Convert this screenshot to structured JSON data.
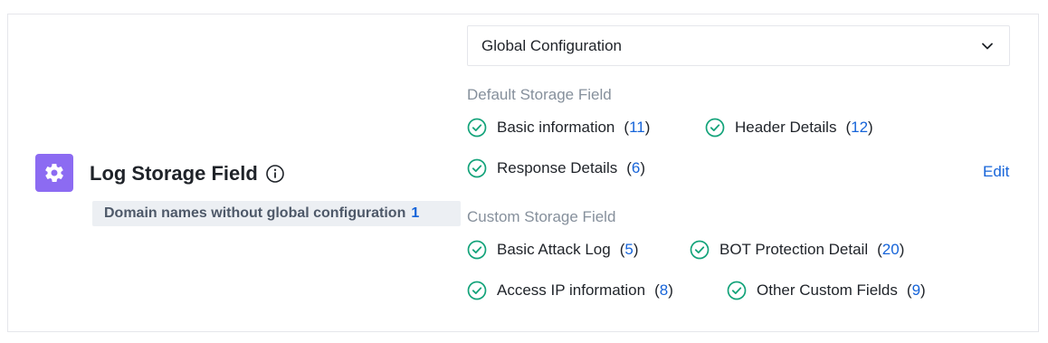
{
  "feature": {
    "title": "Log Storage Field",
    "domain_tag_label": "Domain names without global configuration",
    "domain_tag_count": "1"
  },
  "config_select": {
    "value": "Global Configuration"
  },
  "default_section": {
    "label": "Default Storage Field",
    "fields": [
      {
        "name": "Basic information",
        "count": "11"
      },
      {
        "name": "Header Details",
        "count": "12"
      },
      {
        "name": "Response Details",
        "count": "6"
      }
    ]
  },
  "custom_section": {
    "label": "Custom Storage Field",
    "fields": [
      {
        "name": "Basic Attack Log",
        "count": "5"
      },
      {
        "name": "BOT Protection Detail",
        "count": "20"
      },
      {
        "name": "Access IP information",
        "count": "8"
      },
      {
        "name": "Other Custom Fields",
        "count": "9"
      }
    ]
  },
  "actions": {
    "edit_label": "Edit"
  },
  "colors": {
    "icon_bg": "#8c6bf2",
    "check": "#13a37a",
    "link": "#1664d9"
  },
  "icons": {
    "feature": "gear-icon",
    "info": "info-icon",
    "select": "chevron-down-icon",
    "field": "check-circle-icon"
  }
}
